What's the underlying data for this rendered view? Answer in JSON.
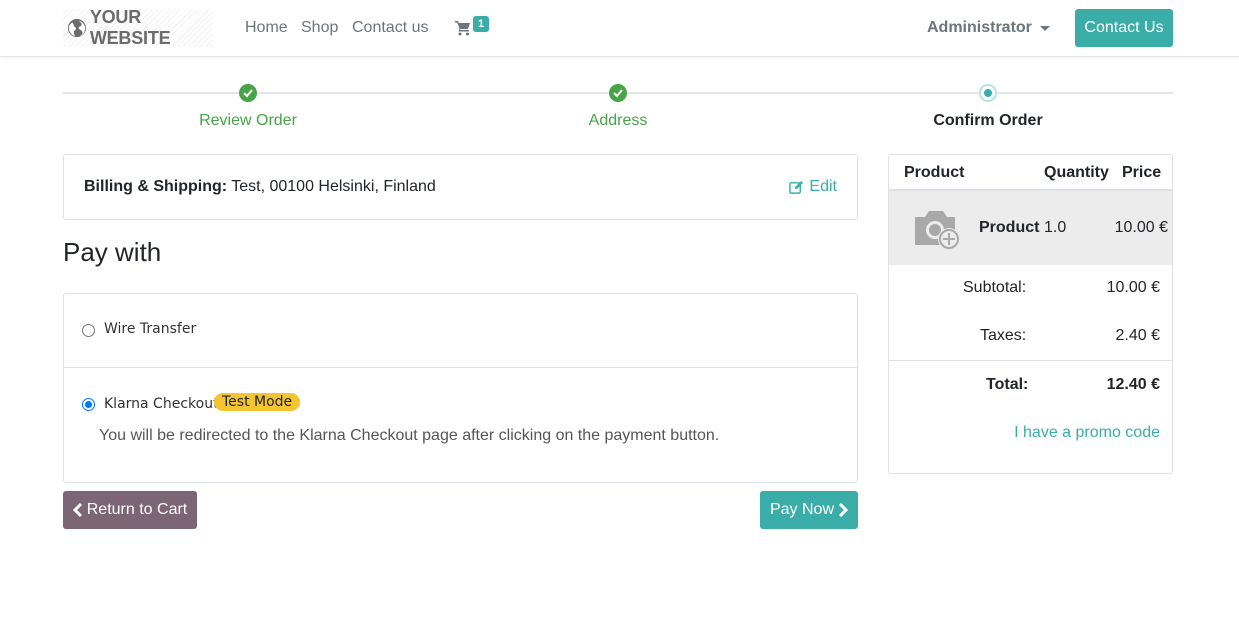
{
  "header": {
    "logo_text": "YOUR WEBSITE",
    "nav": [
      "Home",
      "Shop",
      "Contact us"
    ],
    "cart_count": "1",
    "user": "Administrator",
    "contact_button": "Contact Us"
  },
  "wizard": {
    "steps": [
      {
        "label": "Review Order",
        "state": "done"
      },
      {
        "label": "Address",
        "state": "done"
      },
      {
        "label": "Confirm Order",
        "state": "current"
      }
    ]
  },
  "billing": {
    "label": "Billing & Shipping:",
    "value": " Test, 00100 Helsinki, Finland",
    "edit": "Edit"
  },
  "payment": {
    "title": "Pay with",
    "options": [
      {
        "label": "Wire Transfer",
        "selected": false
      },
      {
        "label": "Klarna Checkout",
        "selected": true,
        "badge": "Test Mode",
        "description": "You will be redirected to the Klarna Checkout page after clicking on the payment button."
      }
    ]
  },
  "actions": {
    "return": "Return to Cart",
    "pay": "Pay Now"
  },
  "summary": {
    "headers": {
      "product": "Product",
      "quantity": "Quantity",
      "price": "Price"
    },
    "item": {
      "name": "Product",
      "quantity": "1.0",
      "price": "10.00 €"
    },
    "subtotal_label": "Subtotal:",
    "subtotal": "10.00 €",
    "taxes_label": "Taxes:",
    "taxes": "2.40 €",
    "total_label": "Total:",
    "total": "12.40 €",
    "promo": "I have a promo code"
  },
  "colors": {
    "primary": "#3aada8",
    "success": "#47a447",
    "secondary_button": "#7c6576",
    "badge_warning": "#f4c531"
  }
}
